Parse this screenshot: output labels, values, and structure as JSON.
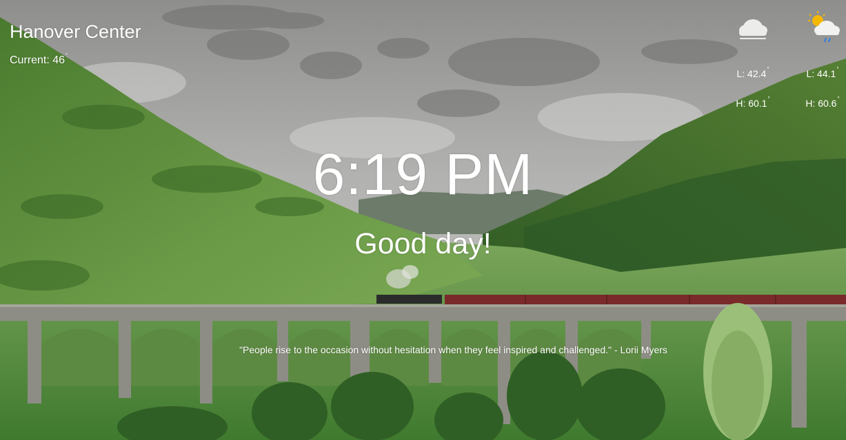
{
  "weather": {
    "location": "Hanover Center",
    "current_label": "Current:",
    "current_temp": "46",
    "forecast": [
      {
        "icon": "cloud-icon",
        "low": "L: 42.4",
        "high": "H: 60.1"
      },
      {
        "icon": "partly-sunny-rain-icon",
        "low": "L: 44.1",
        "high": "H: 60.6"
      }
    ]
  },
  "clock": {
    "time": "6:19 PM"
  },
  "greeting": "Good day!",
  "quote": "\"People rise to the occasion without hesitation when they feel inspired and challenged.\" - Lorii Myers",
  "colors": {
    "text": "#ffffff",
    "sky": "#9a9a98",
    "hills": "#4f7a35",
    "train": "#7a2a2a",
    "viaduct": "#8a8a82"
  }
}
